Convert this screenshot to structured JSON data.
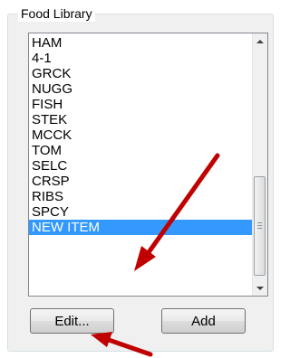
{
  "group": {
    "title": "Food Library"
  },
  "list": {
    "items": [
      "HAM",
      "4-1",
      "GRCK",
      "NUGG",
      "FISH",
      "STEK",
      "MCCK",
      "TOM",
      "SELC",
      "CRSP",
      "RIBS",
      "SPCY",
      "NEW ITEM"
    ],
    "selected": "NEW ITEM"
  },
  "buttons": {
    "edit_label": "Edit...",
    "add_label": "Add"
  },
  "colors": {
    "selection": "#3399ff",
    "annotation_arrow": "#c00000"
  },
  "icons": [
    "scroll-up-arrow-icon",
    "scroll-down-arrow-icon",
    "scroll-grip-icon",
    "annotation-arrow"
  ]
}
